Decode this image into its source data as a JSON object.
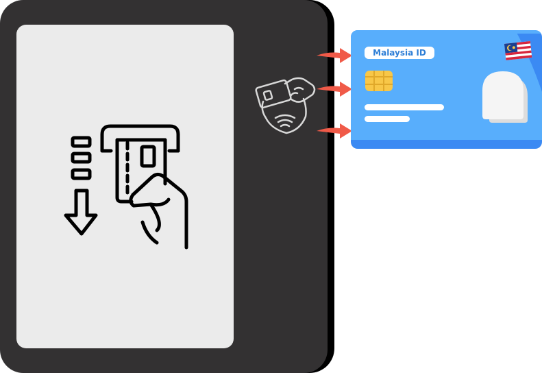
{
  "card": {
    "label": "Malaysia ID",
    "color_bg": "#58aefc",
    "color_dark": "#3b8af3",
    "chip_color": "#f8c748",
    "flag_icon": "malaysia-flag-icon"
  },
  "device": {
    "body_color": "#333132",
    "screen_color": "#ebebeb",
    "screen_icon": "card-insert-icon",
    "reader_icon": "hand-card-nfc-icon"
  },
  "arrows": {
    "color": "#f05a48",
    "count": 3
  }
}
